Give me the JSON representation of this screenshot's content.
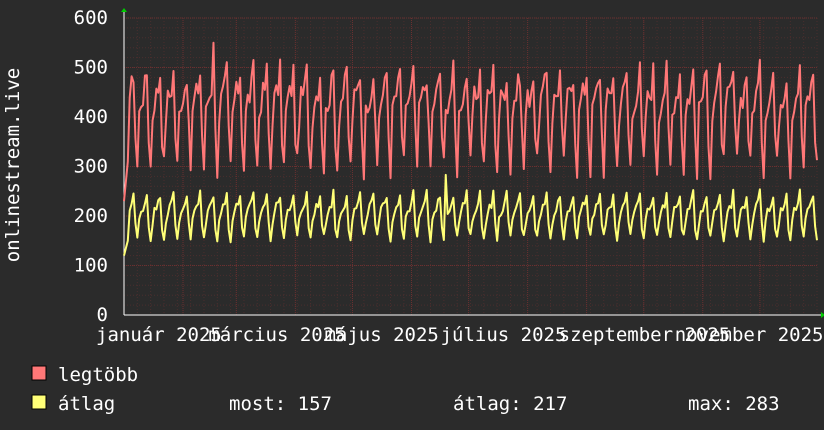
{
  "chart_data": {
    "type": "line",
    "ylabel": "onlinestream.live",
    "ylim": [
      0,
      600
    ],
    "yticks": [
      0,
      100,
      200,
      300,
      400,
      500,
      600
    ],
    "x_tick_labels": [
      "január 2025",
      "március 2025",
      "május 2025",
      "július 2025",
      "szeptember 2025",
      "november 2025"
    ],
    "x_range": [
      "2025-01-01",
      "2025-12-31"
    ],
    "grid": true,
    "series": [
      {
        "name": "legtöbb",
        "color": "#ff7777",
        "weekly_pattern": [
          300,
          405,
          435,
          445,
          460,
          490,
          365
        ],
        "start_value": 230,
        "peak_value": 550
      },
      {
        "name": "átlag",
        "color": "#ffff77",
        "weekly_pattern": [
          155,
          190,
          210,
          218,
          225,
          245,
          180
        ],
        "start_value": 120,
        "peak_value": 283
      }
    ],
    "legend": {
      "placement": "bottom",
      "items": [
        {
          "label": "legtöbb",
          "color": "#ff7777"
        },
        {
          "label": "átlag",
          "color": "#ffff77"
        }
      ]
    },
    "stats": {
      "most": "most: 157",
      "atlag": "átlag: 217",
      "max": "max: 283"
    }
  }
}
